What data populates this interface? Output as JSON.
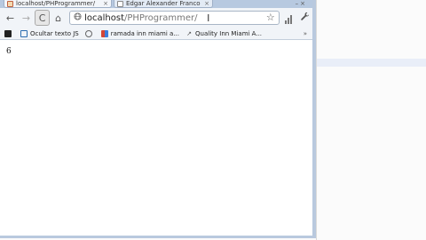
{
  "tabs": [
    {
      "label": "localhost/PHProgrammer/",
      "close": "×",
      "active": true
    },
    {
      "label": "Edgar Alexander Franco",
      "close": "×",
      "active": false
    }
  ],
  "window_controls": [
    "–",
    "×"
  ],
  "toolbar": {
    "back_glyph": "←",
    "forward_glyph": "→",
    "reload_glyph": "C",
    "home_glyph": "⌂",
    "url_host": "localhost",
    "url_path": "/PHProgrammer/",
    "star_glyph": "☆",
    "wrench_glyph": "🔧",
    "cursor_glyph": "I"
  },
  "bookmarks": [
    {
      "label": "",
      "icon": "app-icon",
      "color": "#222222"
    },
    {
      "label": "Ocultar texto JS",
      "icon": "page-icon",
      "color": "#2b6cb0"
    },
    {
      "label": "",
      "icon": "globe-icon",
      "color": "#666666"
    },
    {
      "label": "ramada inn miami a...",
      "icon": "google-icon",
      "color": "#d44638"
    },
    {
      "label": "Quality Inn Miami A...",
      "icon": "arrow-icon",
      "color": "#555555"
    }
  ],
  "bookmarks_more": "»",
  "page": {
    "output": "6"
  },
  "colors": {
    "frame": "#c7d5e8",
    "toolbar": "#f1f4f8"
  }
}
